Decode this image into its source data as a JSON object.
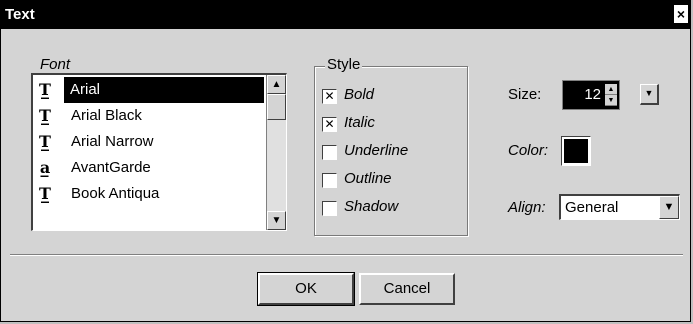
{
  "window": {
    "title": "Text",
    "close_glyph": "×"
  },
  "font_group": {
    "legend": "Font",
    "items": [
      {
        "label": "Arial",
        "icon": "truetype-icon",
        "glyph": "T̲",
        "selected": true
      },
      {
        "label": "Arial Black",
        "icon": "truetype-icon",
        "glyph": "T̲",
        "selected": false
      },
      {
        "label": "Arial Narrow",
        "icon": "truetype-icon",
        "glyph": "T̲",
        "selected": false
      },
      {
        "label": "AvantGarde",
        "icon": "printer-font-icon",
        "glyph": "a̲",
        "selected": false
      },
      {
        "label": "Book Antiqua",
        "icon": "truetype-icon",
        "glyph": "T̲",
        "selected": false
      }
    ]
  },
  "style_group": {
    "legend": "Style",
    "options": [
      {
        "label": "Bold",
        "checked": true
      },
      {
        "label": "Italic",
        "checked": true
      },
      {
        "label": "Underline",
        "checked": false
      },
      {
        "label": "Outline",
        "checked": false
      },
      {
        "label": "Shadow",
        "checked": false
      }
    ]
  },
  "size": {
    "label": "Size:",
    "value": "12"
  },
  "color": {
    "label": "Color:",
    "value": "#000000"
  },
  "align": {
    "label": "Align:",
    "value": "General"
  },
  "buttons": {
    "ok": "OK",
    "cancel": "Cancel"
  }
}
